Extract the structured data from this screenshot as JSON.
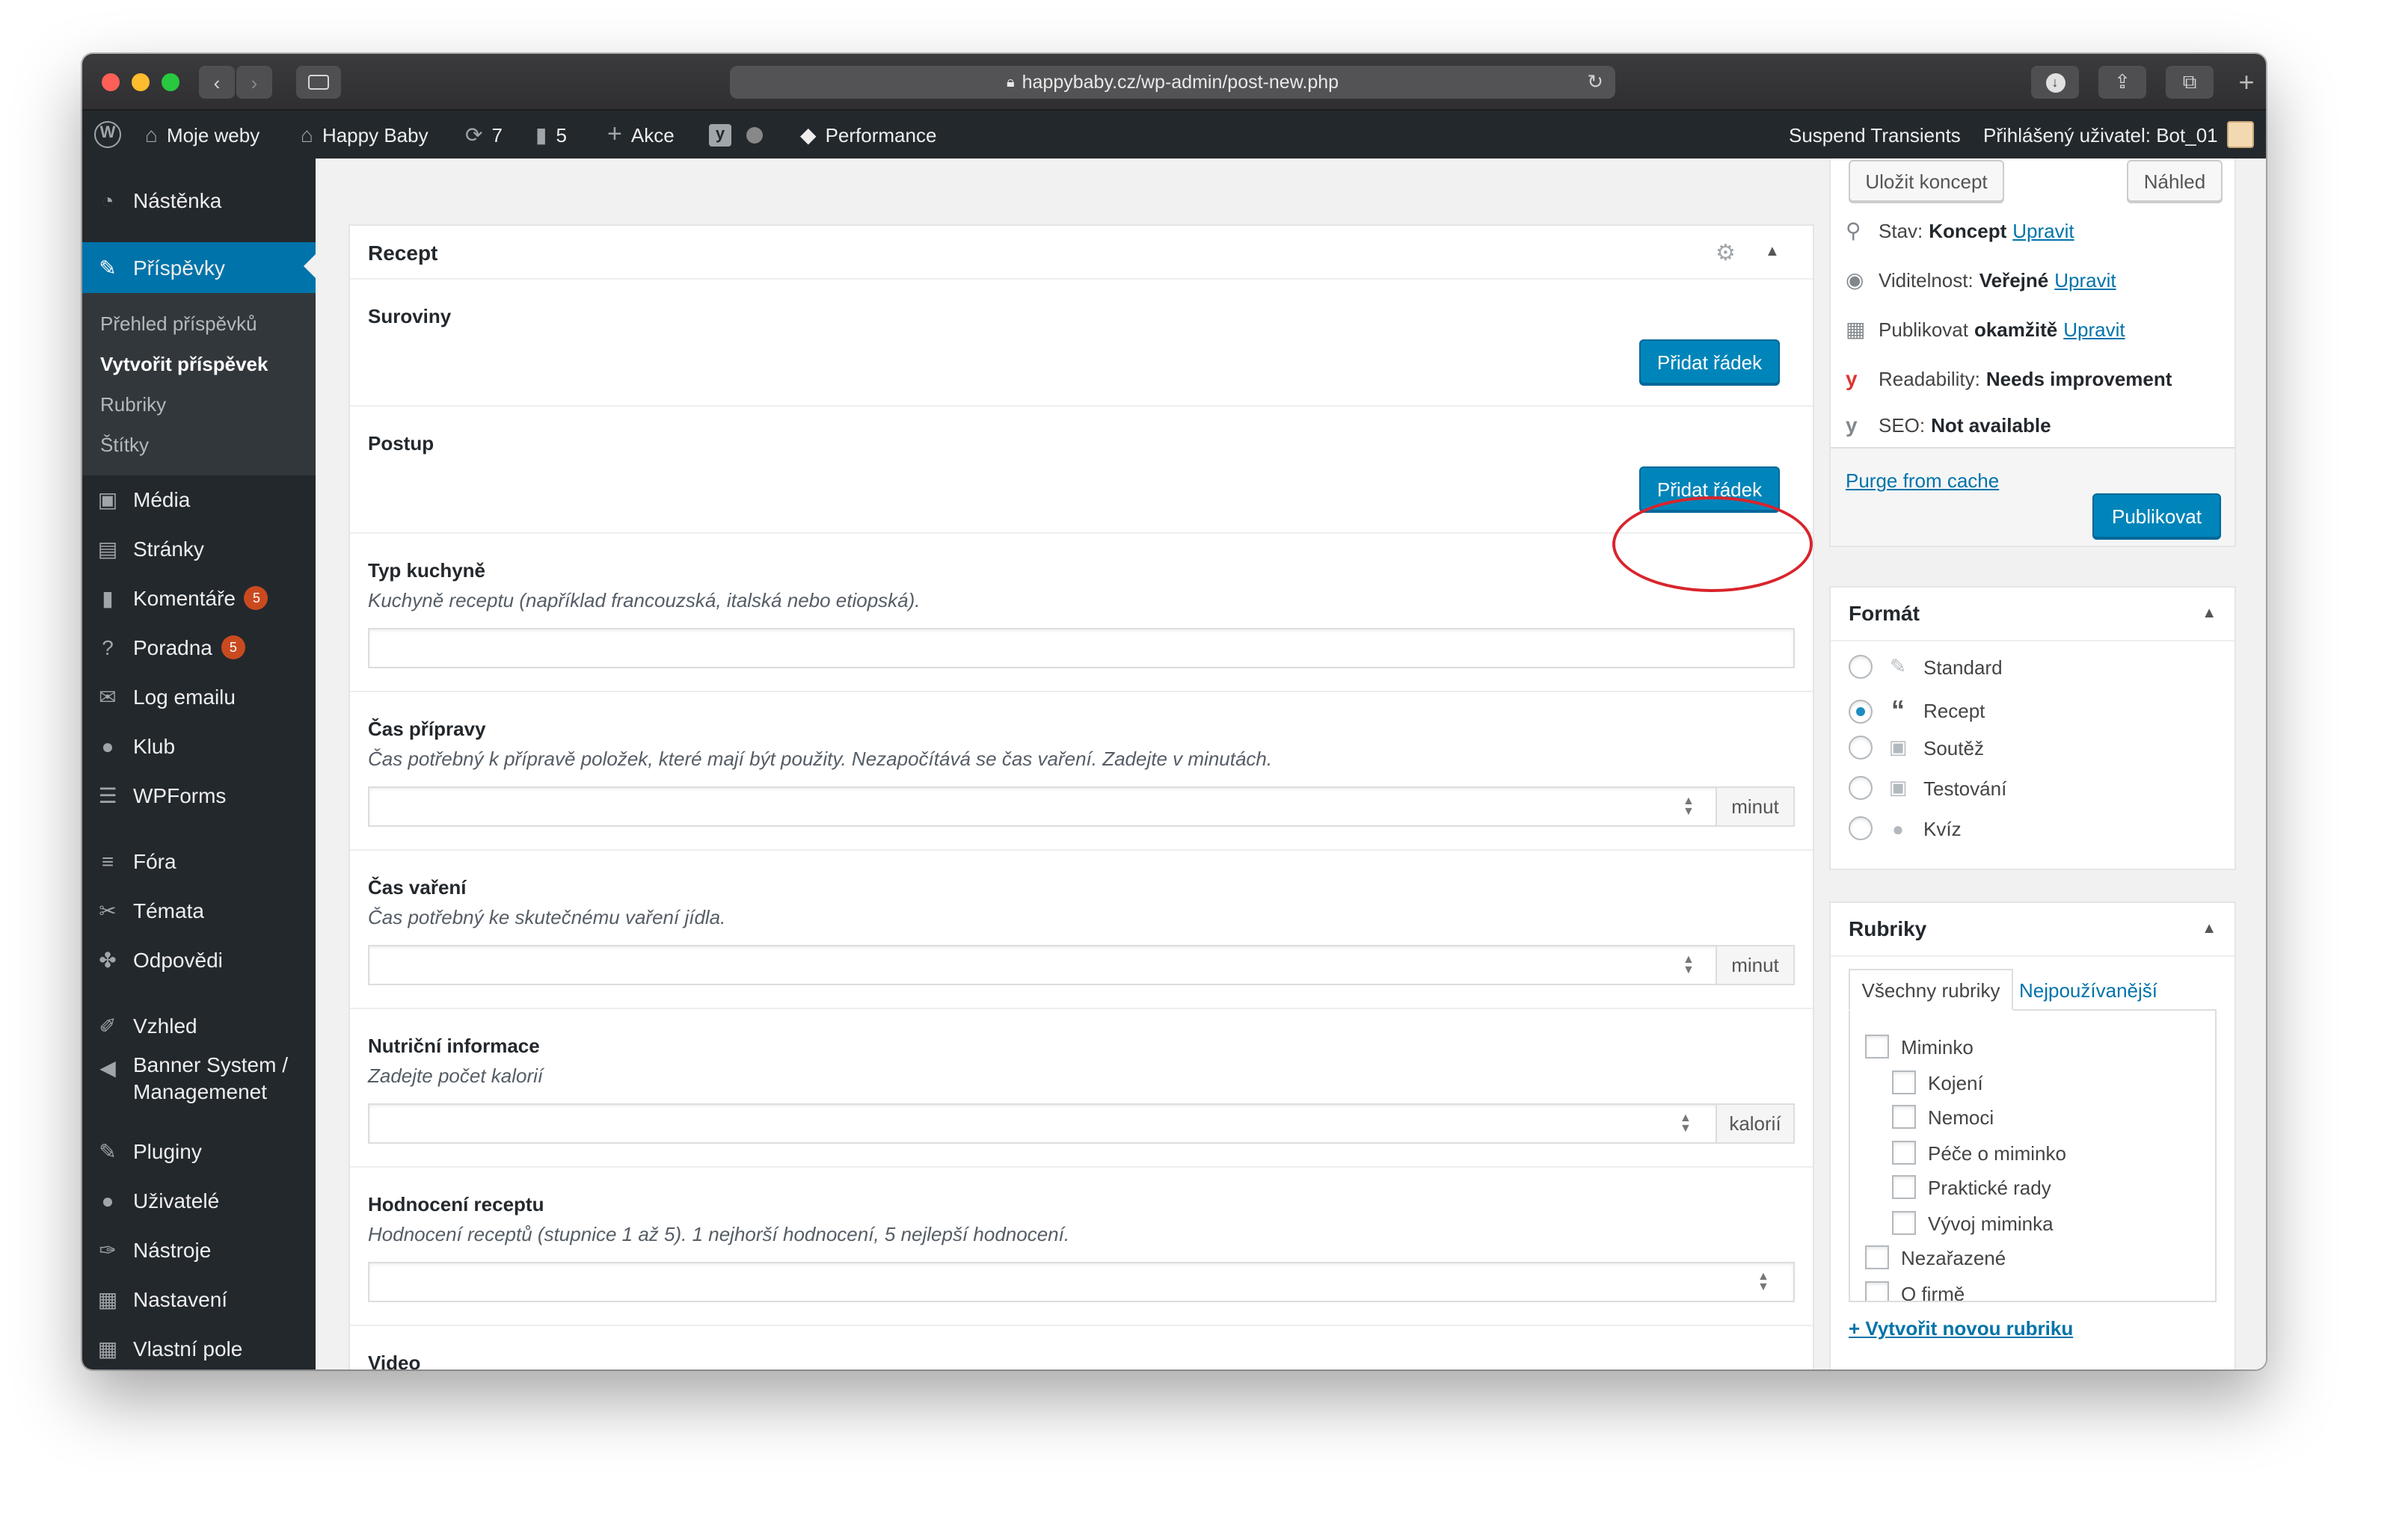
{
  "browser": {
    "url": "happybaby.cz/wp-admin/post-new.php"
  },
  "adminbar": {
    "my_sites": "Moje weby",
    "site_name": "Happy Baby",
    "updates_count": "7",
    "comments_count": "5",
    "new_label": "Akce",
    "performance": "Performance",
    "suspend": "Suspend Transients",
    "user": "Přihlášený uživatel: Bot_01"
  },
  "sidebar": {
    "dashboard": "Nástěnka",
    "posts": "Příspěvky",
    "sub_all": "Přehled příspěvků",
    "sub_new": "Vytvořit příspěvek",
    "sub_categories": "Rubriky",
    "sub_tags": "Štítky",
    "media": "Média",
    "pages": "Stránky",
    "comments": "Komentáře",
    "comments_badge": "5",
    "help": "Poradna",
    "help_badge": "5",
    "email_log": "Log emailu",
    "club": "Klub",
    "wpforms": "WPForms",
    "forums": "Fóra",
    "topics": "Témata",
    "replies": "Odpovědi",
    "appearance": "Vzhled",
    "banner_1": "Banner System /",
    "banner_2": "Managemenet",
    "plugins": "Pluginy",
    "users": "Uživatelé",
    "tools": "Nástroje",
    "settings": "Nastavení",
    "custom_fields": "Vlastní pole"
  },
  "recipe": {
    "title": "Recept",
    "ingredients": "Suroviny",
    "steps": "Postup",
    "add_row": "Přidat řádek",
    "cuisine_label": "Typ kuchyně",
    "cuisine_desc": "Kuchyně receptu (například francouzská, italská nebo etiopská).",
    "prep_label": "Čas přípravy",
    "prep_desc": "Čas potřebný k přípravě položek, které mají být použity. Nezapočítává se čas vaření. Zadejte v minutách.",
    "cook_label": "Čas vaření",
    "cook_desc": "Čas potřebný ke skutečnému vaření jídla.",
    "unit_minutes": "minut",
    "nutrition_label": "Nutriční informace",
    "nutrition_desc": "Zadejte počet kalorií",
    "unit_calories": "kalorií",
    "rating_label": "Hodnocení receptu",
    "rating_desc": "Hodnocení receptů (stupnice 1 až 5). 1 nejhorší hodnocení, 5 nejlepší hodnocení.",
    "video_label": "Video"
  },
  "publish": {
    "save_draft": "Uložit koncept",
    "preview": "Náhled",
    "status_label": "Stav:",
    "status_value": "Koncept",
    "visibility_label": "Viditelnost:",
    "visibility_value": "Veřejné",
    "publish_label": "Publikovat",
    "publish_value": "okamžitě",
    "edit": "Upravit",
    "readability_label": "Readability:",
    "readability_value": "Needs improvement",
    "seo_label": "SEO:",
    "seo_value": "Not available",
    "purge": "Purge from cache",
    "publish_button": "Publikovat"
  },
  "format": {
    "title": "Formát",
    "options": [
      "Standard",
      "Recept",
      "Soutěž",
      "Testování",
      "Kvíz"
    ],
    "selected": "Recept"
  },
  "categories": {
    "title": "Rubriky",
    "tab_all": "Všechny rubriky",
    "tab_popular": "Nejpoužívanější",
    "items": [
      "Miminko",
      "Kojení",
      "Nemoci",
      "Péče o miminko",
      "Praktické rady",
      "Vývoj miminka",
      "Nezařazené",
      "O firmě"
    ],
    "add_new": "+ Vytvořit novou rubriku"
  },
  "colors": {
    "accent": "#0085ba",
    "menu_bg": "#23282d",
    "highlight": "#d9242c"
  }
}
